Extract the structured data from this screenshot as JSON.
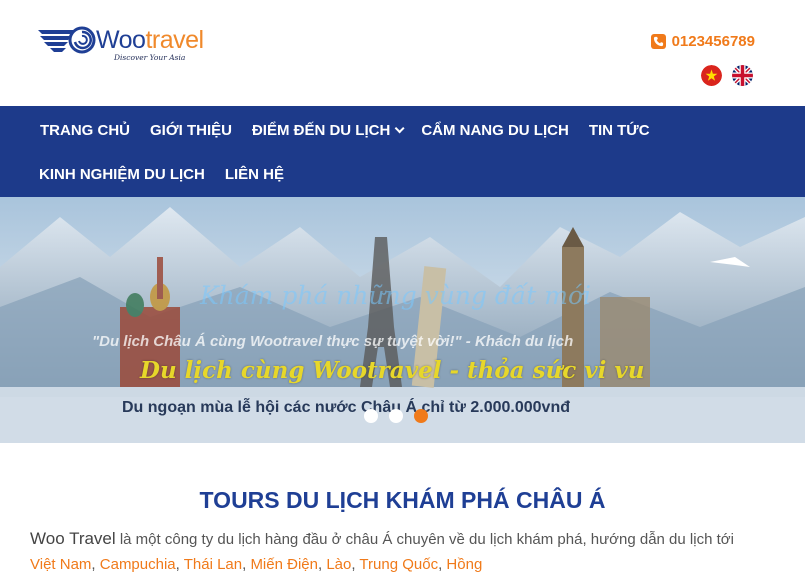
{
  "brand": {
    "name_main": "Woo",
    "name_accent": "travel",
    "tagline": "Discover Your Asia",
    "primary_color": "#1f3f95",
    "accent_color": "#f0892b"
  },
  "header": {
    "phone_icon": "phone-icon",
    "phone": "0123456789",
    "languages": [
      {
        "name": "vietnamese",
        "icon": "vietnam-flag-icon"
      },
      {
        "name": "english",
        "icon": "uk-flag-icon"
      }
    ]
  },
  "nav": {
    "background": "#1d3a8a",
    "items": [
      {
        "label": "TRANG CHỦ"
      },
      {
        "label": "GIỚI THIỆU"
      },
      {
        "label": "ĐIỂM ĐẾN DU LỊCH",
        "has_dropdown": true
      },
      {
        "label": "CẨM NANG DU LỊCH"
      },
      {
        "label": "TIN TỨC"
      },
      {
        "label": "KINH NGHIỆM DU LỊCH"
      },
      {
        "label": "LIÊN HỆ"
      }
    ]
  },
  "hero": {
    "line1": "Khám phá những vùng đất mới",
    "line2": "\"Du lịch Châu Á cùng Wootravel thực sự tuyệt vời!\" - Khách du lịch",
    "line3": "Du lịch cùng Wootravel - thỏa sức vi vu",
    "line4": "Du ngoạn mùa lễ hội các nước Châu Á chỉ từ 2.000.000vnđ",
    "slides": 3,
    "active_slide": 3
  },
  "main": {
    "section_title": "TOURS DU LỊCH KHÁM PHÁ CHÂU Á",
    "intro_brand": "Woo Travel",
    "intro_text": " là một công ty du lịch hàng đầu ở châu Á chuyên về du lịch khám phá, hướng dẫn du lịch tới ",
    "destinations": [
      "Việt Nam",
      "Campuchia",
      "Thái Lan",
      "Miến Điện",
      "Lào",
      "Trung Quốc",
      "Hồng"
    ]
  }
}
